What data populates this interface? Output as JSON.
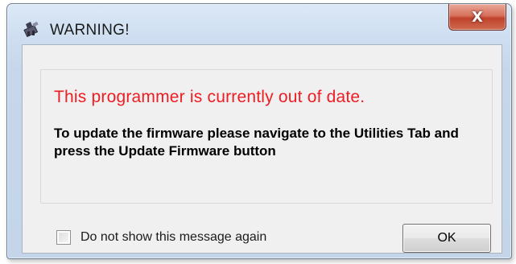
{
  "window": {
    "title": "WARNING!",
    "icon": "programmer-app-icon",
    "close_label": "X"
  },
  "message": {
    "headline": "This programmer is currently out of date.",
    "instructions": "To update the firmware please navigate to the Utilities Tab and press the Update Firmware button"
  },
  "footer": {
    "checkbox_label": "Do not show this message again",
    "checkbox_checked": false,
    "ok_label": "OK"
  },
  "colors": {
    "headline": "#ee1d23",
    "close_button": "#c0432c"
  }
}
